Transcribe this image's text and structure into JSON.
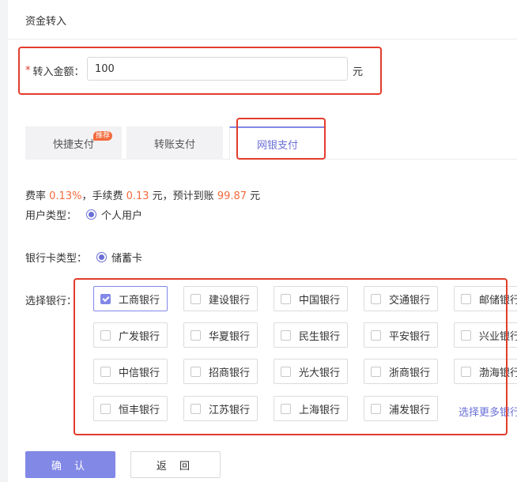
{
  "header": {
    "title": "资金转入"
  },
  "amount": {
    "required_mark": "*",
    "label": "转入金额：",
    "value": "100",
    "unit": "元"
  },
  "tabs": [
    {
      "label": "快捷支付",
      "badge": "推荐",
      "active": false
    },
    {
      "label": "转账支付",
      "active": false
    },
    {
      "label": "网银支付",
      "active": true
    }
  ],
  "fee": {
    "rate_prefix": "费率 ",
    "rate": "0.13%",
    "fee_prefix": "，手续费 ",
    "fee": "0.13",
    "arrive_prefix": " 元，预计到账 ",
    "arrive": "99.87",
    "suffix": " 元"
  },
  "user_type": {
    "label": "用户类型：",
    "option": "个人用户"
  },
  "card_type": {
    "label": "银行卡类型：",
    "option": "储蓄卡"
  },
  "bank_select": {
    "label": "选择银行：",
    "banks": [
      [
        "工商银行",
        "建设银行",
        "中国银行",
        "交通银行",
        "邮储银行"
      ],
      [
        "广发银行",
        "华夏银行",
        "民生银行",
        "平安银行",
        "兴业银行"
      ],
      [
        "中信银行",
        "招商银行",
        "光大银行",
        "浙商银行",
        "渤海银行"
      ],
      [
        "恒丰银行",
        "江苏银行",
        "上海银行",
        "浦发银行"
      ]
    ],
    "selected": "工商银行",
    "more_label": "选择更多银行"
  },
  "actions": {
    "confirm": "确 认",
    "back": "返 回"
  },
  "colors": {
    "accent": "#8288e6",
    "highlight": "#f36a3c",
    "annotation": "#e23c2c"
  }
}
